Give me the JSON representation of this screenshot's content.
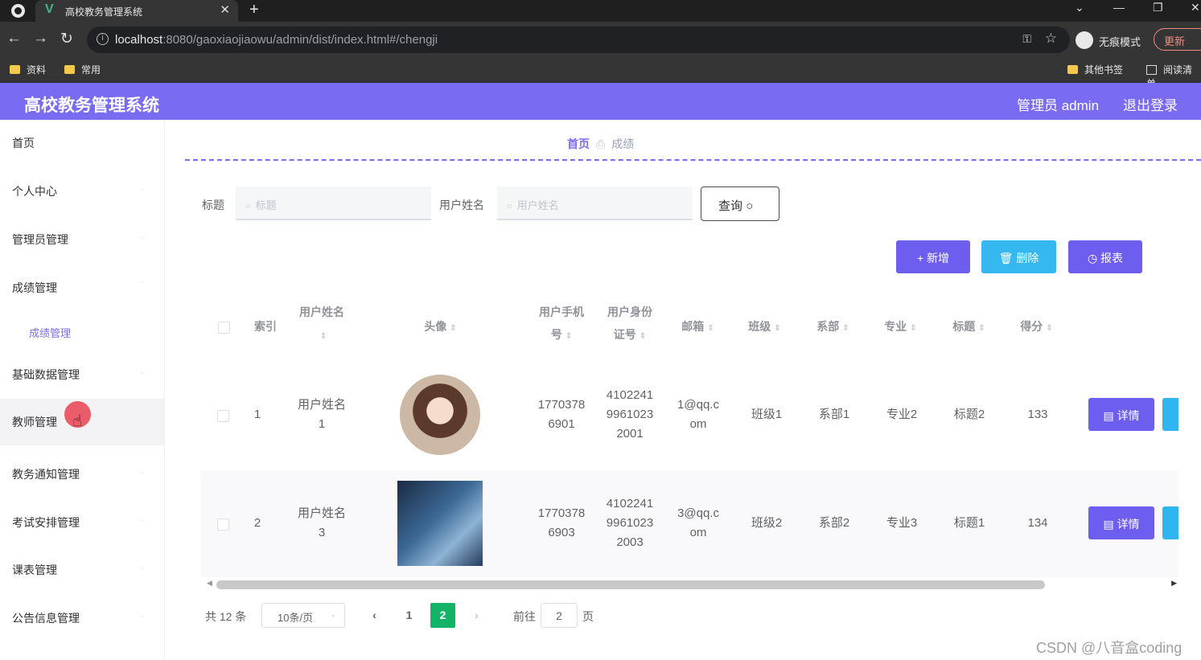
{
  "browser": {
    "tab_title": "高校教务管理系统",
    "url_host": "localhost",
    "url_path": ":8080/gaoxiaojiaowu/admin/dist/index.html#/chengji",
    "incognito_label": "无痕模式",
    "update_label": "更新",
    "bookmarks": [
      "资料",
      "常用"
    ],
    "bookmarks_right": [
      "其他书签",
      "阅读清单"
    ]
  },
  "header": {
    "title": "高校教务管理系统",
    "user": "管理员 admin",
    "logout": "退出登录",
    "accent_color": "#7a6cf2"
  },
  "sidebar": {
    "items": [
      "首页",
      "个人中心",
      "管理员管理",
      "成绩管理",
      "基础数据管理",
      "教师管理",
      "教务通知管理",
      "考试安排管理",
      "课表管理",
      "公告信息管理"
    ],
    "sub_item": "成绩管理",
    "active": "教师管理"
  },
  "breadcrumb": {
    "home": "首页",
    "current": "成绩"
  },
  "search": {
    "title_label": "标题",
    "title_placeholder": "标题",
    "username_label": "用户姓名",
    "username_placeholder": "用户姓名",
    "query_button": "查询"
  },
  "actions": {
    "add": "新增",
    "delete": "删除",
    "report": "报表",
    "add_color": "#6d5ef0",
    "delete_color": "#35b8f0",
    "report_color": "#6d5ef0"
  },
  "table": {
    "headers": {
      "index": "索引",
      "username_1": "用户姓名",
      "avatar": "头像",
      "phone_1": "用户手机",
      "phone_2": "号",
      "idcard_1": "用户身份",
      "idcard_2": "证号",
      "email": "邮箱",
      "class": "班级",
      "dept": "系部",
      "major": "专业",
      "title": "标题",
      "score": "得分"
    },
    "rows": [
      {
        "index": "1",
        "name_1": "用户姓名",
        "name_2": "1",
        "phone_1": "1770378",
        "phone_2": "6901",
        "id_1": "4102241",
        "id_2": "9961023",
        "id_3": "2001",
        "email_1": "1@qq.c",
        "email_2": "om",
        "class": "班级1",
        "dept": "系部1",
        "major": "专业2",
        "title": "标题2",
        "score": "133",
        "detail": "详情"
      },
      {
        "index": "2",
        "name_1": "用户姓名",
        "name_2": "3",
        "phone_1": "1770378",
        "phone_2": "6903",
        "id_1": "4102241",
        "id_2": "9961023",
        "id_3": "2003",
        "email_1": "3@qq.c",
        "email_2": "om",
        "class": "班级2",
        "dept": "系部2",
        "major": "专业3",
        "title": "标题1",
        "score": "134",
        "detail": "详情"
      }
    ]
  },
  "pagination": {
    "total": "共 12 条",
    "page_size": "10条/页",
    "pages": [
      "1",
      "2"
    ],
    "current_page": "2",
    "goto_label": "前往",
    "goto_value": "2",
    "page_suffix": "页",
    "active_color": "#13b468"
  },
  "watermark": "CSDN @八音盒coding"
}
